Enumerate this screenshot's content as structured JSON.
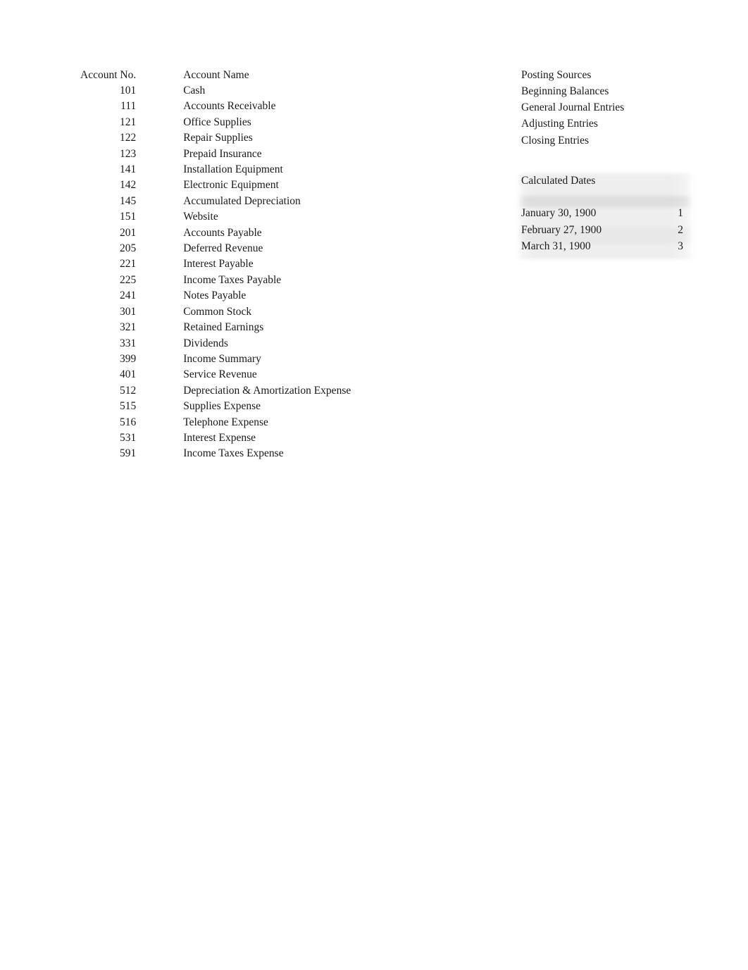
{
  "accounts": {
    "headers": {
      "number": "Account No.",
      "name": "Account Name"
    },
    "rows": [
      {
        "number": "101",
        "name": "Cash"
      },
      {
        "number": "111",
        "name": "Accounts Receivable"
      },
      {
        "number": "121",
        "name": "Office Supplies"
      },
      {
        "number": "122",
        "name": "Repair Supplies"
      },
      {
        "number": "123",
        "name": "Prepaid Insurance"
      },
      {
        "number": "141",
        "name": "Installation Equipment"
      },
      {
        "number": "142",
        "name": "Electronic Equipment"
      },
      {
        "number": "145",
        "name": "Accumulated Depreciation"
      },
      {
        "number": "151",
        "name": "Website"
      },
      {
        "number": "201",
        "name": "Accounts Payable"
      },
      {
        "number": "205",
        "name": "Deferred Revenue"
      },
      {
        "number": "221",
        "name": "Interest Payable"
      },
      {
        "number": "225",
        "name": "Income Taxes Payable"
      },
      {
        "number": "241",
        "name": "Notes Payable"
      },
      {
        "number": "301",
        "name": "Common Stock"
      },
      {
        "number": "321",
        "name": "Retained Earnings"
      },
      {
        "number": "331",
        "name": "Dividends"
      },
      {
        "number": "399",
        "name": "Income Summary"
      },
      {
        "number": "401",
        "name": "Service Revenue"
      },
      {
        "number": "512",
        "name": "Depreciation & Amortization Expense"
      },
      {
        "number": "515",
        "name": "Supplies Expense"
      },
      {
        "number": "516",
        "name": "Telephone Expense"
      },
      {
        "number": "531",
        "name": "Interest Expense"
      },
      {
        "number": "591",
        "name": "Income Taxes Expense"
      }
    ]
  },
  "posting_sources": {
    "title": "Posting Sources",
    "items": [
      "Beginning Balances",
      "General Journal Entries",
      "Adjusting Entries",
      "Closing Entries"
    ]
  },
  "calculated_dates": {
    "title": "Calculated Dates",
    "rows": [
      {
        "date": "January 30, 1900",
        "value": "1"
      },
      {
        "date": "February 27, 1900",
        "value": "2"
      },
      {
        "date": "March 31, 1900",
        "value": "3"
      }
    ]
  }
}
